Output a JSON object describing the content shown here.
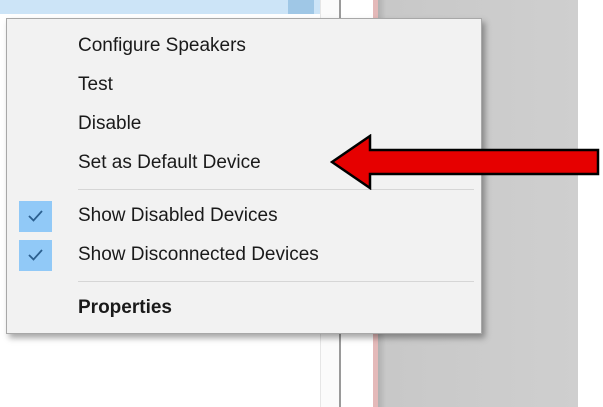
{
  "menu": {
    "items": [
      {
        "label": "Configure Speakers",
        "checked": false
      },
      {
        "label": "Test",
        "checked": false
      },
      {
        "label": "Disable",
        "checked": false
      },
      {
        "label": "Set as Default Device",
        "checked": false
      },
      {
        "label": "Show Disabled Devices",
        "checked": true
      },
      {
        "label": "Show Disconnected Devices",
        "checked": true
      },
      {
        "label": "Properties",
        "checked": false,
        "bold": true
      }
    ]
  },
  "annotation": {
    "arrow_color": "#e60000",
    "points_to": "Set as Default Device"
  },
  "colors": {
    "check_bg": "#91c9f7",
    "menu_bg": "#f2f2f2",
    "highlight": "#cce4f7"
  }
}
